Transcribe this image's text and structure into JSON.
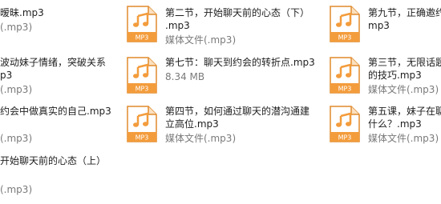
{
  "icon_kind": "mp3-audio-file-icon",
  "colors": {
    "accent": "#f39c3c",
    "meta": "#7a7a7a",
    "text": "#1e1e1e"
  },
  "col0": [
    {
      "lines": [
        "暧昧.mp3"
      ],
      "meta": "(.mp3)"
    },
    {
      "lines": [
        "波动妹子情绪，突破关系",
        "p3"
      ],
      "meta": "(.mp3)"
    },
    {
      "lines": [
        "约会中做真实的自己.mp3"
      ],
      "meta": "(.mp3)"
    },
    {
      "lines": [
        "开始聊天前的心态（上）"
      ],
      "meta": "(.mp3)"
    }
  ],
  "col1": [
    {
      "lines": [
        "第二节，开始聊天前的心态（下）",
        ".mp3"
      ],
      "meta": "媒体文件(.mp3)",
      "icon_label": "MP3"
    },
    {
      "lines": [
        "第七节：聊天到约会的转折点.mp3"
      ],
      "meta": "8.34 MB",
      "icon_label": "MP3"
    },
    {
      "lines": [
        "第四节，如何通过聊天的潜沟通建",
        "立高位.mp3"
      ],
      "meta": "媒体文件(.mp3)",
      "icon_label": "MP3"
    }
  ],
  "col2": [
    {
      "lines": [
        "第九节，正确邀约",
        "mp3"
      ],
      "meta": "",
      "icon_label": "MP3"
    },
    {
      "lines": [
        "第三节，无限话题",
        "的技巧.mp3"
      ],
      "meta": "媒体文件(.mp3)",
      "icon_label": "MP3"
    },
    {
      "lines": [
        "第五课，妹子在聊",
        "什么？.mp3"
      ],
      "meta": "媒体文件(.mp3)",
      "icon_label": "MP3"
    }
  ]
}
